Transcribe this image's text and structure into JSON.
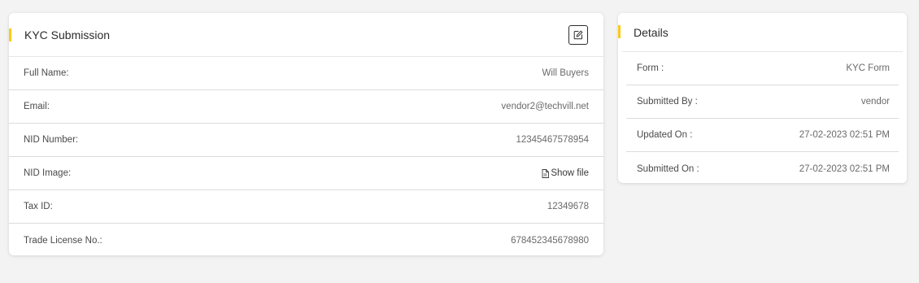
{
  "kyc": {
    "title": "KYC Submission",
    "rows": [
      {
        "label": "Full Name:",
        "value": "Will Buyers"
      },
      {
        "label": "Email:",
        "value": "vendor2@techvill.net"
      },
      {
        "label": "NID Number:",
        "value": "12345467578954"
      },
      {
        "label": "NID Image:",
        "value": "Show file"
      },
      {
        "label": "Tax ID:",
        "value": "12349678"
      },
      {
        "label": "Trade License No.:",
        "value": "678452345678980"
      }
    ]
  },
  "details": {
    "title": "Details",
    "rows": [
      {
        "label": "Form :",
        "value": "KYC Form"
      },
      {
        "label": "Submitted By :",
        "value": "vendor"
      },
      {
        "label": "Updated On :",
        "value": "27-02-2023 02:51 PM"
      },
      {
        "label": "Submitted On :",
        "value": "27-02-2023 02:51 PM"
      }
    ]
  },
  "colors": {
    "accent": "#fcca19",
    "background": "#f3f3f3",
    "card": "#ffffff"
  }
}
